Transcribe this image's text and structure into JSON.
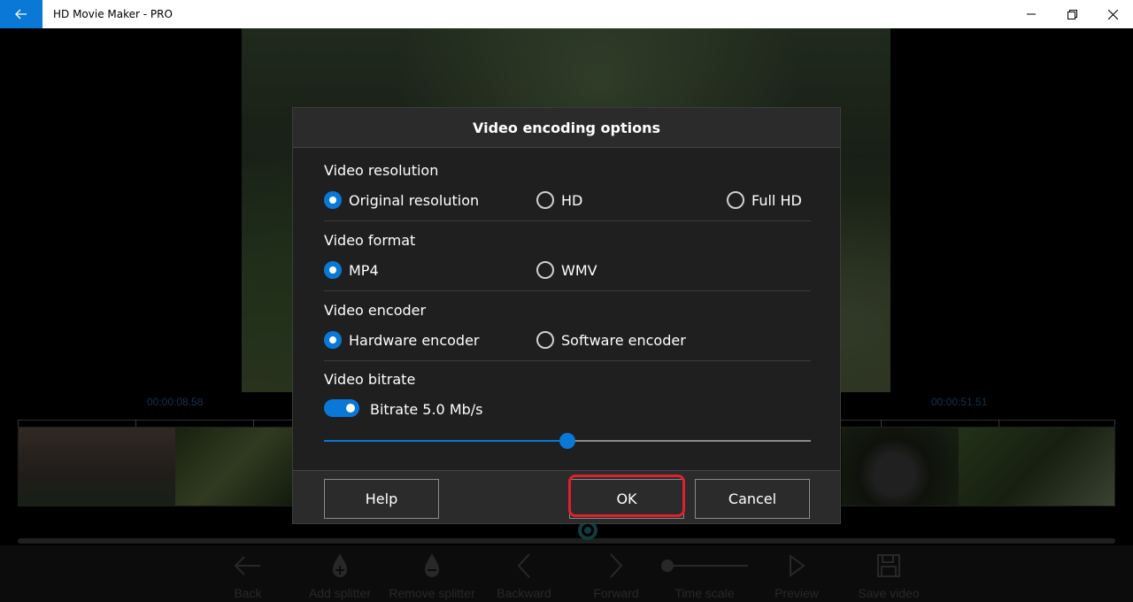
{
  "window": {
    "title": "HD Movie Maker - PRO",
    "controls": [
      "minimize-icon",
      "restore-icon",
      "close-icon"
    ],
    "accent": "#0a78d7"
  },
  "timeline": {
    "time_left": "00:00:08.58",
    "time_right": "00:00:51.51"
  },
  "toolbar": {
    "items": [
      {
        "label": "Back",
        "icon": "arrow-left-icon"
      },
      {
        "label": "Add splitter",
        "icon": "add-splitter-icon"
      },
      {
        "label": "Remove splitter",
        "icon": "remove-splitter-icon"
      },
      {
        "label": "Backward",
        "icon": "chevron-left-icon"
      },
      {
        "label": "Forward",
        "icon": "chevron-right-icon"
      },
      {
        "label": "Time scale",
        "icon": "time-scale-slider-icon"
      },
      {
        "label": "Preview",
        "icon": "play-icon"
      },
      {
        "label": "Save video",
        "icon": "save-icon"
      }
    ]
  },
  "dialog": {
    "title": "Video encoding options",
    "resolution": {
      "label": "Video resolution",
      "options": [
        "Original resolution",
        "HD",
        "Full HD"
      ],
      "selected": "Original resolution"
    },
    "format": {
      "label": "Video format",
      "options": [
        "MP4",
        "WMV"
      ],
      "selected": "MP4"
    },
    "encoder": {
      "label": "Video encoder",
      "options": [
        "Hardware encoder",
        "Software encoder"
      ],
      "selected": "Hardware encoder"
    },
    "bitrate": {
      "label": "Video bitrate",
      "toggle_on": true,
      "toggle_label": "Bitrate 5.0 Mb/s",
      "slider_fraction": 0.5
    },
    "buttons": {
      "help": "Help",
      "ok": "OK",
      "cancel": "Cancel"
    },
    "highlight_color": "#e0202a"
  }
}
